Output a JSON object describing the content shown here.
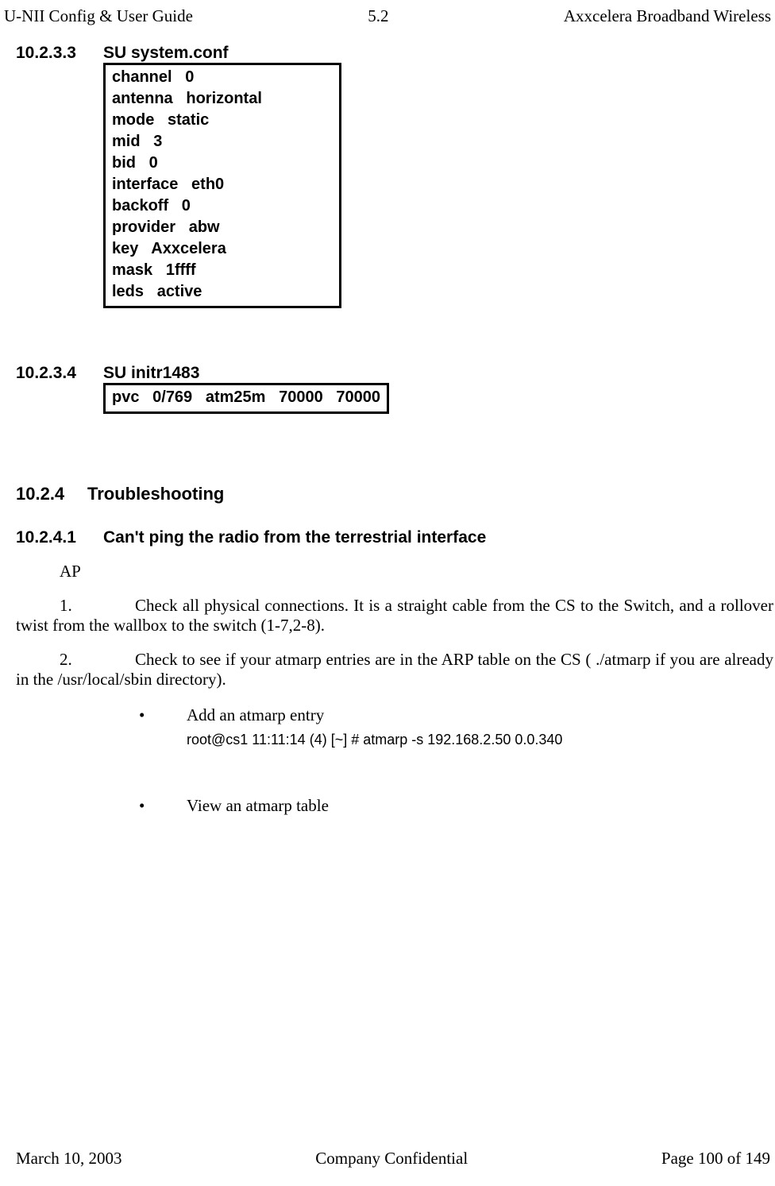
{
  "header": {
    "left": "U-NII Config & User Guide",
    "center": "5.2",
    "right": "Axxcelera Broadband Wireless"
  },
  "sections": {
    "s10_2_3_3": {
      "num": "10.2.3.3",
      "title": "SU system.conf",
      "box": "channel   0\nantenna   horizontal\nmode   static\nmid   3\nbid   0\ninterface   eth0\nbackoff   0\nprovider   abw\nkey   Axxcelera\nmask   1ffff\nleds   active"
    },
    "s10_2_3_4": {
      "num": "10.2.3.4",
      "title": "SU initr1483",
      "box": "pvc   0/769   atm25m   70000   70000"
    },
    "s10_2_4": {
      "num": "10.2.4",
      "title": "Troubleshooting"
    },
    "s10_2_4_1": {
      "num": "10.2.4.1",
      "title": "Can't ping the radio from the terrestrial interface"
    }
  },
  "body": {
    "ap": "AP",
    "item1_num": "1.",
    "item1_text": "Check all physical connections. It is a straight cable from the CS to the Switch, and a rollover twist from the wallbox to the switch (1-7,2-8).",
    "item2_num": "2.",
    "item2_text": "Check to see if your atmarp entries are in the ARP table on the CS ( ./atmarp if you are already in the /usr/local/sbin directory).",
    "bullet_glyph": "•",
    "bullet1": "Add an atmarp entry",
    "code1": "root@cs1 11:11:14 (4) [~] #   atmarp   -s   192.168.2.50   0.0.340",
    "bullet2": "View an atmarp table"
  },
  "footer": {
    "left": "March 10, 2003",
    "center": "Company Confidential",
    "right": "Page 100 of 149"
  }
}
